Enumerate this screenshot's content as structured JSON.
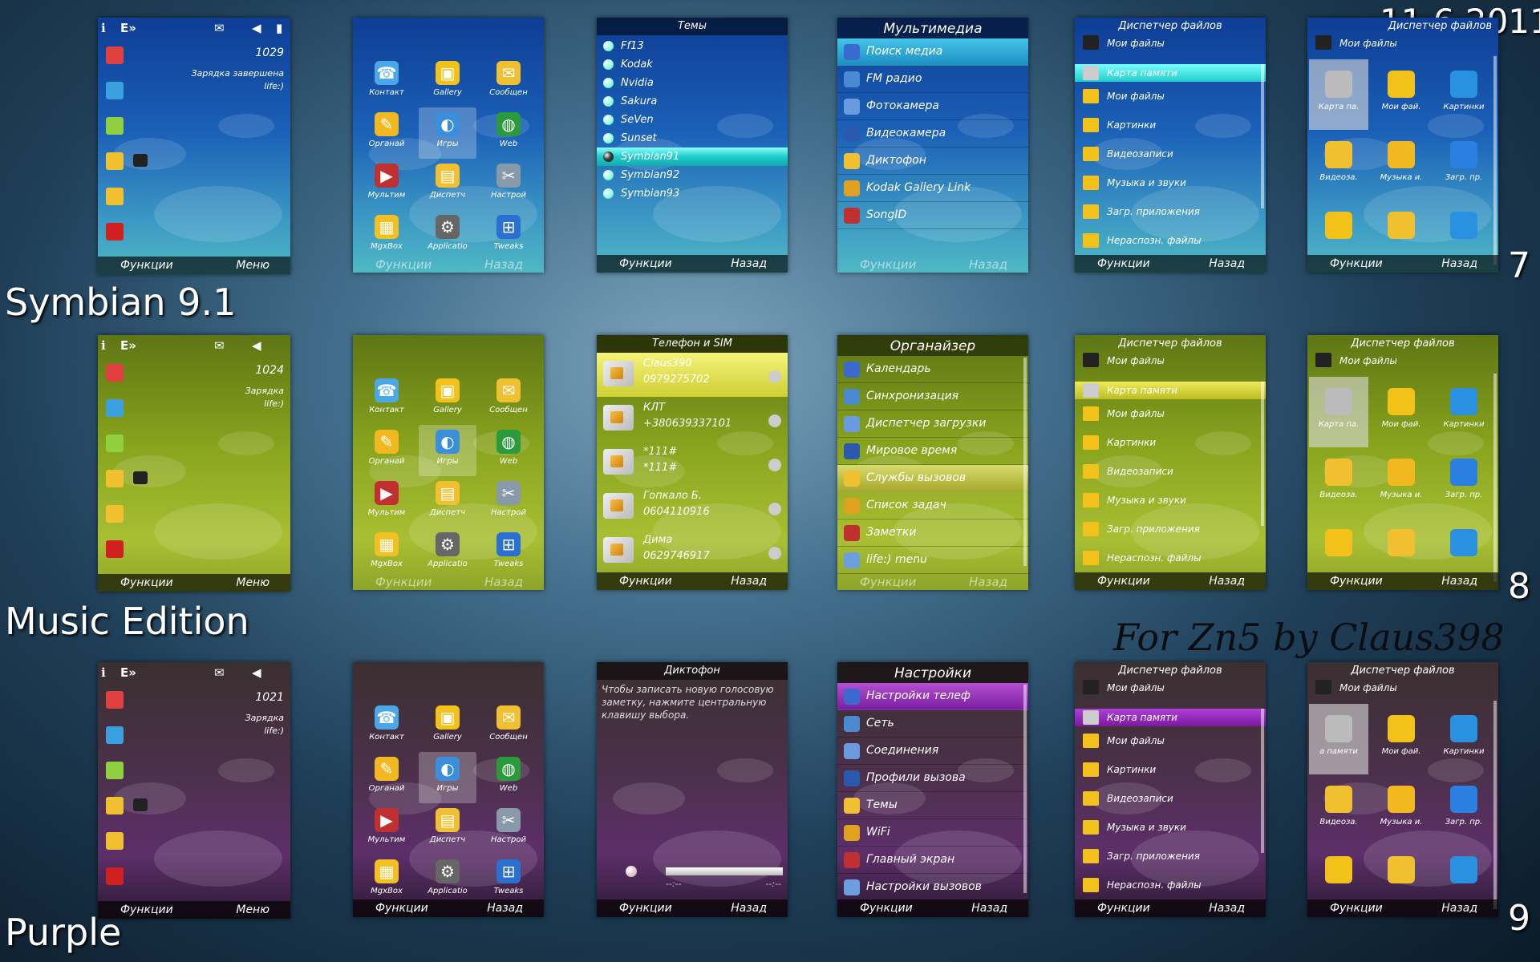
{
  "date": "11.6.2011",
  "credit": "For Zn5 by Claus398",
  "rows": [
    {
      "label": "Symbian 9.1",
      "num": "7",
      "theme": "blue"
    },
    {
      "label": "Music Edition",
      "num": "8",
      "theme": "green"
    },
    {
      "label": "Purple",
      "num": "9",
      "theme": "purple"
    }
  ],
  "softkeys": {
    "functions": "Функции",
    "menu": "Меню",
    "back": "Назад"
  },
  "standby": {
    "status_signal": "E»",
    "clock_values": [
      "1029",
      "1024",
      "1021"
    ],
    "lines_full": [
      "Зарядка завершена",
      "life:)"
    ],
    "lines_short": [
      "Зарядка",
      "life:)"
    ]
  },
  "menu_grid": [
    "Контакт",
    "Gallery",
    "Сообщен",
    "Органай",
    "Игры",
    "Web",
    "Мультим",
    "Диспетч",
    "Настрой",
    "MgxBox",
    "Applicatio",
    "Tweaks"
  ],
  "themes_screen": {
    "title": "Темы",
    "items": [
      "Ff13",
      "Kodak",
      "Nvidia",
      "Sakura",
      "SeVen",
      "Sunset",
      "Symbian91",
      "Symbian92",
      "Symbian93"
    ],
    "selected_index": 6
  },
  "multimedia": {
    "title": "Мультимедиа",
    "items": [
      "Поиск медиа",
      "FM радио",
      "Фотокамера",
      "Видеокамера",
      "Диктофон",
      "Kodak Gallery Link",
      "SongID"
    ]
  },
  "file_manager": {
    "title": "Диспетчер файлов",
    "header_item": "Мои файлы",
    "items": [
      "Карта памяти",
      "Мои файлы",
      "Картинки",
      "Видеозаписи",
      "Музыка и звуки",
      "Загр. приложения",
      "Нераспозн. файлы"
    ]
  },
  "file_grid": {
    "labels": [
      "Карта па.",
      "Мои фай.",
      "Картинки",
      "Видеоза.",
      "Музыка и.",
      "Загр. пр."
    ],
    "purple_first": "а памяти",
    "title_short": "Диспетчер файлов"
  },
  "phone_sim": {
    "title": "Телефон и SIM",
    "contacts": [
      {
        "name": "Claus390",
        "number": "0979275702"
      },
      {
        "name": "КЛТ",
        "number": "+380639337101"
      },
      {
        "name": "*111#",
        "number": "*111#"
      },
      {
        "name": "Гопкало Б.",
        "number": "0604110916"
      },
      {
        "name": "Дима",
        "number": "0629746917"
      }
    ]
  },
  "organizer": {
    "title": "Органайзер",
    "items": [
      "Календарь",
      "Синхронизация",
      "Диспетчер загрузки",
      "Мировое время",
      "Службы вызовов",
      "Список задач",
      "Заметки",
      "life:) menu"
    ],
    "selected_index": 4
  },
  "dictaphone": {
    "title": "Диктофон",
    "text": "Чтобы записать новую голосовую заметку, нажмите центральную клавишу выбора.",
    "time_left": "--:--",
    "time_right": "--:--"
  },
  "settings": {
    "title": "Настройки",
    "items": [
      "Настройки телеф",
      "Сеть",
      "Соединения",
      "Профили вызова",
      "Темы",
      "WiFi",
      "Главный экран",
      "Настройки вызовов"
    ]
  },
  "colors": {
    "blue": "#1b61b8",
    "green": "#8aa51e",
    "purple": "#5d2f6a",
    "cyan_select": "#2cc",
    "yellow_select": "#d6db6e",
    "purple_select": "#9a32c0"
  }
}
